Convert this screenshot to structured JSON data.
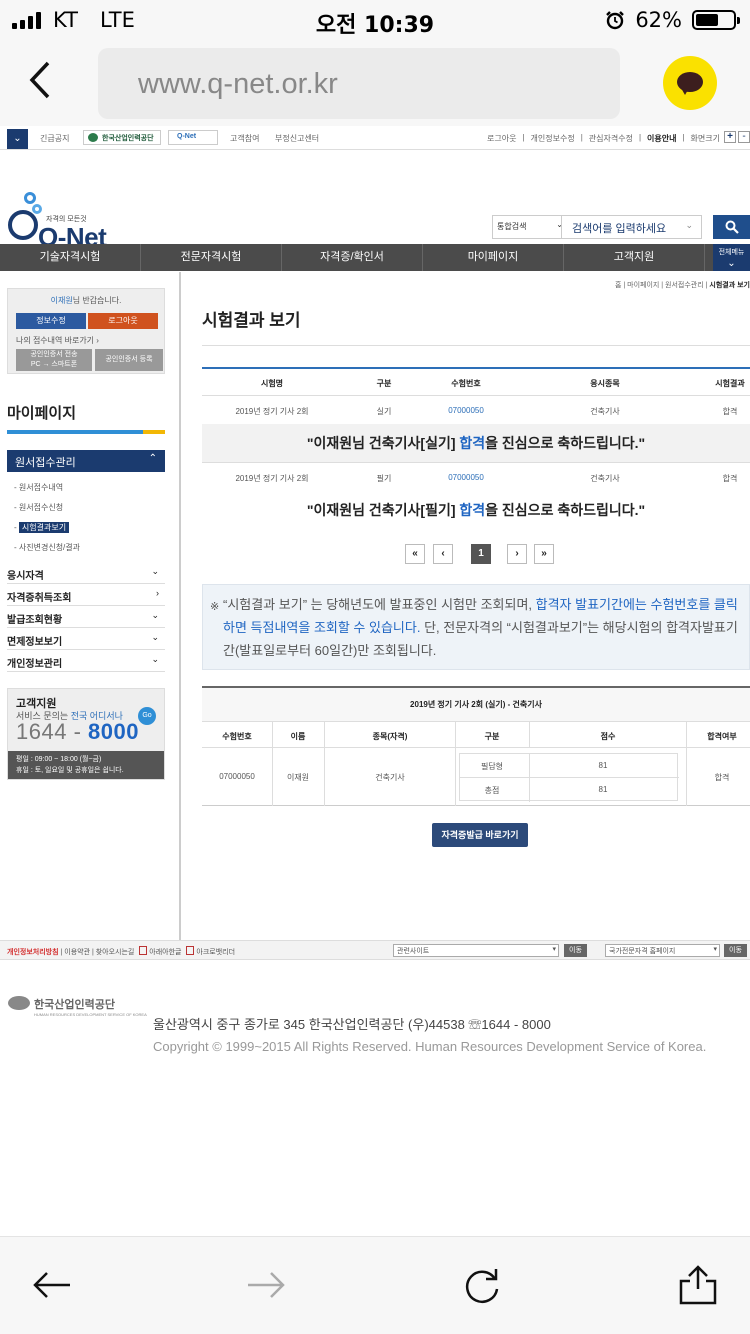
{
  "status": {
    "carrier": "KT",
    "network": "LTE",
    "time": "오전 10:39",
    "battery": "62%",
    "battery_level": 0.62
  },
  "browser": {
    "url": "www.q-net.or.kr"
  },
  "topnav": {
    "notice": "긴급공지",
    "logo1": "한국산업인력공단",
    "logo2": "Q-Net",
    "link1": "고객참여",
    "link2": "부정신고센터",
    "right_links": [
      "로그아웃",
      "개인정보수정",
      "관심자격수정",
      "이용안내",
      "화면크기"
    ]
  },
  "header": {
    "tagline": "자격의 모든것",
    "logo_text": "Q-Net",
    "search_select": "통합검색",
    "search_placeholder": "검색어를 입력하세요"
  },
  "mainnav": {
    "items": [
      "기술자격시험",
      "전문자격시험",
      "자격증/확인서",
      "마이페이지",
      "고객지원"
    ],
    "all": "전체메뉴"
  },
  "sidebar": {
    "user": "이재원",
    "welcome_suffix": "님 반갑습니다.",
    "edit_info": "정보수정",
    "logout": "로그아웃",
    "recent": "나의 접수내역 바로가기",
    "cert_send_1": "공인인증서 전송",
    "cert_send_2": "PC → 스마트폰",
    "cert_register": "공인인증서 등록",
    "title": "마이페이지",
    "active_menu": "원서접수관리",
    "sub_items": [
      "원서접수내역",
      "원서접수신청",
      "시험결과보기",
      "사진변경신청/결과"
    ],
    "menus": [
      "응시자격",
      "자격증취득조회",
      "발급조회현황",
      "면제정보보기",
      "개인정보관리"
    ],
    "cs_title": "고객지원",
    "cs_sub_1": "서비스 문의는",
    "cs_sub_2": "전국 어디서나",
    "cs_go": "Go",
    "cs_num_a": "1644",
    "cs_num_dash": " - ",
    "cs_num_b": "8000",
    "cs_hours_1": "평일 : 09:00 ~ 18:00 (월~금)",
    "cs_hours_2": "휴일 : 토, 일요일 및 공휴일은 쉽니다."
  },
  "content": {
    "breadcrumb_1": "홈",
    "breadcrumb_2": "마이페이지",
    "breadcrumb_3": "원서접수관리",
    "breadcrumb_4": "시험결과 보기",
    "title": "시험결과 보기",
    "table_headers": [
      "시험명",
      "구분",
      "수험번호",
      "응시종목",
      "시험결과"
    ],
    "rows": [
      {
        "exam": "2019년 정기 기사 2회",
        "type": "실기",
        "number": "07000050",
        "subject": "건축기사",
        "result": "합격"
      },
      {
        "exam": "2019년 정기 기사 2회",
        "type": "필기",
        "number": "07000050",
        "subject": "건축기사",
        "result": "합격"
      }
    ],
    "congrats": [
      {
        "pre": "\"이재원님 건축기사[실기] ",
        "hl": "합격",
        "post": "을 진심으로 축하드립니다.\""
      },
      {
        "pre": "\"이재원님 건축기사[필기] ",
        "hl": "합격",
        "post": "을 진심으로 축하드립니다.\""
      }
    ],
    "pager": {
      "first": "«",
      "prev": "‹",
      "current": "1",
      "next": "›",
      "last": "»"
    },
    "notice": {
      "mark": "※",
      "p1": "“시험결과 보기” 는 당해년도에 발표중인 시험만 조회되며, ",
      "p2": "합격자 발표기간에는 수험번호를 클릭하면 득점내역을 조회할 수 있습니다.",
      "p3": " 단, 전문자격의 “시험결과보기”는 해당시험의 합격자발표기간(발표일로부터 60일간)만 조회됩니다."
    },
    "detail": {
      "caption": "2019년 정기 기사 2회 (실기) - 건축기사",
      "headers": [
        "수험번호",
        "이름",
        "종목(자격)",
        "구분",
        "점수",
        "합격여부"
      ],
      "number": "07000050",
      "name": "이재원",
      "subject": "건축기사",
      "type_1": "필답형",
      "score_1": "81",
      "type_2": "총점",
      "score_2": "81",
      "result": "합격"
    },
    "cert_button": "자격증발급 바로가기"
  },
  "footer": {
    "privacy": "개인정보처리방침",
    "terms": "이용약관",
    "directions": "찾아오시는길",
    "archive1": "아래아한글",
    "archive2": "아크로뱃리더",
    "related": "관련사이트",
    "go": "이동",
    "national": "국가전문자격 홈페이지",
    "org": "한국산업인력공단",
    "org_en": "HUMAN RESOURCES DEVELOPMENT SERVICE OF KOREA",
    "address": "울산광역시 중구 종가로 345 한국산업인력공단 (우)44538 ☏1644 - 8000",
    "copyright": "Copyright © 1999~2015 All Rights Reserved. Human Resources Development Service of Korea."
  }
}
